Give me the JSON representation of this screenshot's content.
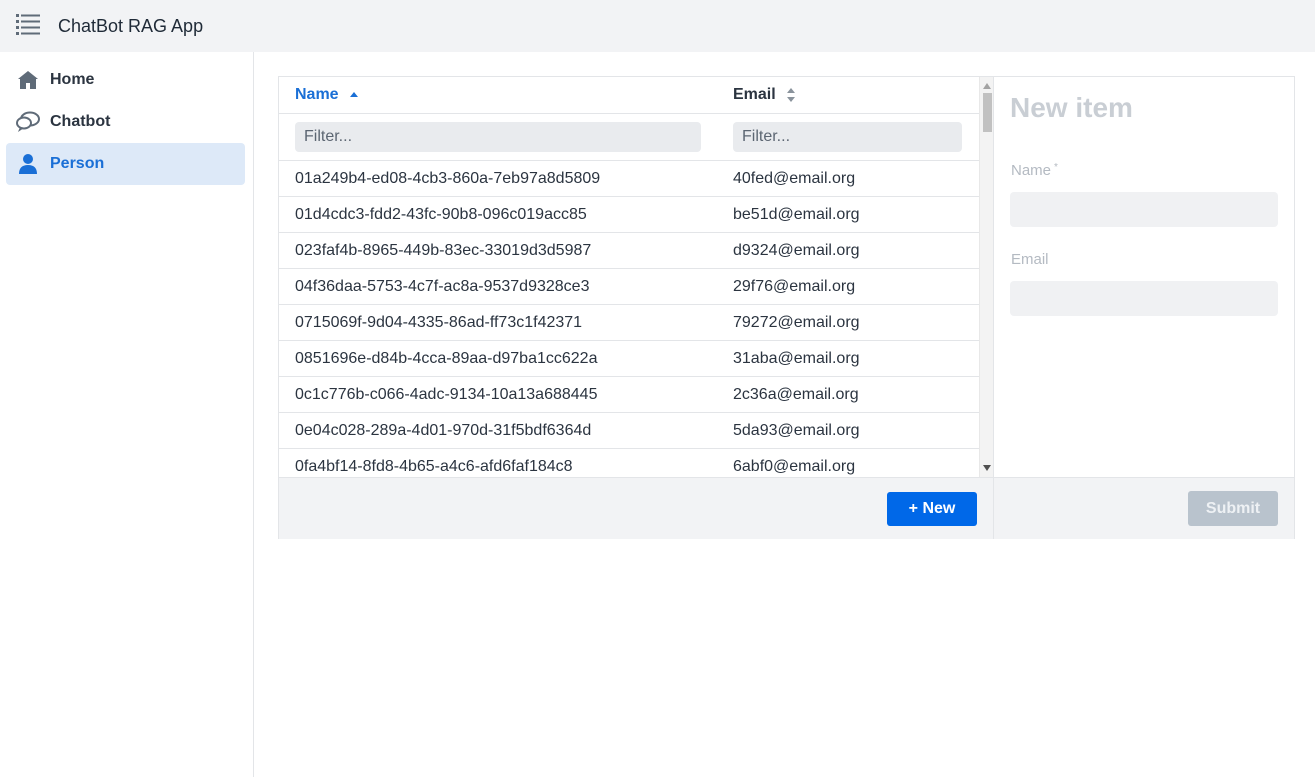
{
  "app": {
    "title": "ChatBot RAG App",
    "menu_icon": "list-icon"
  },
  "sidebar": {
    "items": [
      {
        "label": "Home",
        "icon": "home-icon",
        "active": false
      },
      {
        "label": "Chatbot",
        "icon": "chat-icon",
        "active": false
      },
      {
        "label": "Person",
        "icon": "person-icon",
        "active": true
      }
    ]
  },
  "grid": {
    "columns": [
      {
        "label": "Name",
        "sort": "ascending"
      },
      {
        "label": "Email",
        "sort": "none"
      }
    ],
    "filters": {
      "name_placeholder": "Filter...",
      "email_placeholder": "Filter..."
    },
    "rows": [
      {
        "name": "01a249b4-ed08-4cb3-860a-7eb97a8d5809",
        "email": "40fed@email.org"
      },
      {
        "name": "01d4cdc3-fdd2-43fc-90b8-096c019acc85",
        "email": "be51d@email.org"
      },
      {
        "name": "023faf4b-8965-449b-83ec-33019d3d5987",
        "email": "d9324@email.org"
      },
      {
        "name": "04f36daa-5753-4c7f-ac8a-9537d9328ce3",
        "email": "29f76@email.org"
      },
      {
        "name": "0715069f-9d04-4335-86ad-ff73c1f42371",
        "email": "79272@email.org"
      },
      {
        "name": "0851696e-d84b-4cca-89aa-d97ba1cc622a",
        "email": "31aba@email.org"
      },
      {
        "name": "0c1c776b-c066-4adc-9134-10a13a688445",
        "email": "2c36a@email.org"
      },
      {
        "name": "0e04c028-289a-4d01-970d-31f5bdf6364d",
        "email": "5da93@email.org"
      },
      {
        "name": "0fa4bf14-8fd8-4b65-a4c6-afd6faf184c8",
        "email": "6abf0@email.org"
      }
    ],
    "new_button": "+ New"
  },
  "form": {
    "title": "New item",
    "fields": [
      {
        "label": "Name",
        "required_mark": "*",
        "value": ""
      },
      {
        "label": "Email",
        "value": ""
      }
    ],
    "submit_label": "Submit"
  },
  "colors": {
    "accent": "#0068e8",
    "active_nav_bg": "#dde9f8",
    "active_text": "#1a6fd6"
  }
}
